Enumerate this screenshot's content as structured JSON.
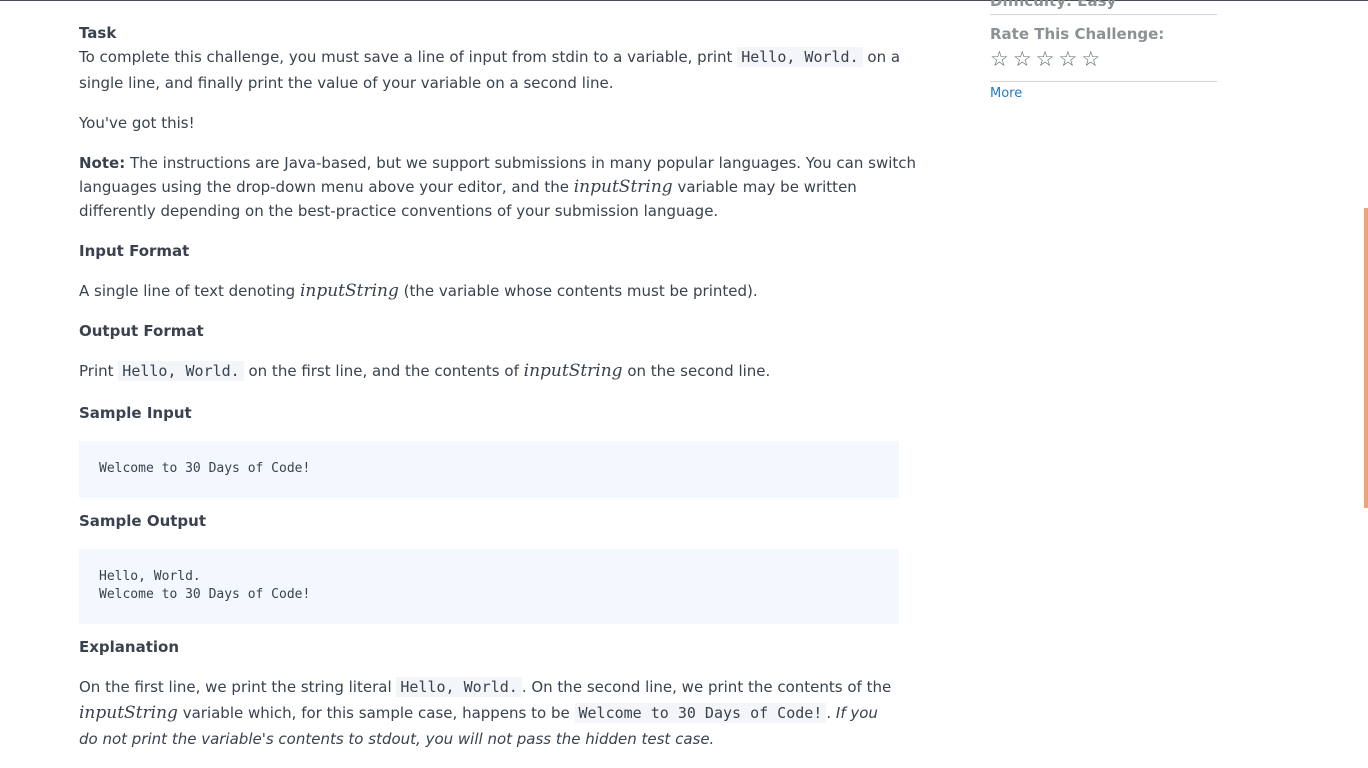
{
  "task": {
    "heading": "Task",
    "line1_a": "To complete this challenge, you must save a line of input from stdin to a variable, print",
    "line1_code": "Hello, World.",
    "line1_b": "on a",
    "line2": "single line, and finally print the value of your variable on a second line.",
    "encourage": "You've got this!"
  },
  "note": {
    "label": "Note:",
    "line1": "The instructions are Java-based, but we support submissions in many popular languages. You can switch",
    "line2_a": "languages using the drop-down menu above your editor, and the",
    "line2_var": "inputString",
    "line2_b": "variable may be written",
    "line3": "differently depending on the best-practice conventions of your submission language."
  },
  "input_format": {
    "heading": "Input Format",
    "text_a": "A single line of text denoting",
    "text_var": "inputString",
    "text_b": "(the variable whose contents must be printed)."
  },
  "output_format": {
    "heading": "Output Format",
    "text_a": "Print",
    "text_code": "Hello, World.",
    "text_b": "on the first line, and the contents of",
    "text_var": "inputString",
    "text_c": "on the second line."
  },
  "sample_input": {
    "heading": "Sample Input",
    "line1": "Welcome to 30 Days of Code!"
  },
  "sample_output": {
    "heading": "Sample Output",
    "line1": "Hello, World.",
    "line2": "Welcome to 30 Days of Code!"
  },
  "explanation": {
    "heading": "Explanation",
    "l1_a": "On the first line, we print the string literal",
    "l1_code": "Hello, World.",
    "l1_b": ". On the second line, we print the contents of the",
    "l2_var": "inputString",
    "l2_a": "variable which, for this sample case, happens to be",
    "l2_code": "Welcome to 30 Days of Code!",
    "l2_b": ".",
    "l2_em": "If you",
    "l3_em": "do not print the variable's contents to stdout, you will not pass the hidden test case."
  },
  "sidebar": {
    "difficulty_cut": "Difficulty: Easy",
    "rate_label": "Rate This Challenge:",
    "stars": [
      "☆",
      "☆",
      "☆",
      "☆",
      "☆"
    ],
    "more_link": "More"
  }
}
